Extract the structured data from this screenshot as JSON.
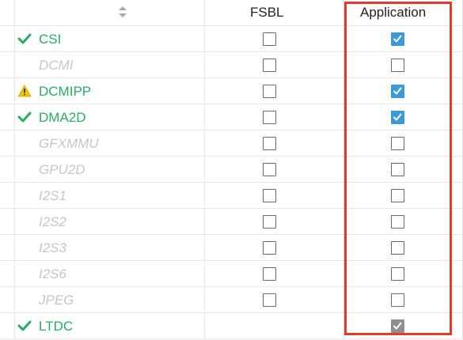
{
  "table": {
    "columns": [
      "",
      "FSBL",
      "Application"
    ],
    "rows": [
      {
        "name": "CSI",
        "status": "ok",
        "enabled": true,
        "fsbl": "unchecked",
        "application": "checked"
      },
      {
        "name": "DCMI",
        "status": "none",
        "enabled": false,
        "fsbl": "unchecked",
        "application": "unchecked"
      },
      {
        "name": "DCMIPP",
        "status": "warning",
        "enabled": true,
        "fsbl": "unchecked",
        "application": "checked"
      },
      {
        "name": "DMA2D",
        "status": "ok",
        "enabled": true,
        "fsbl": "unchecked",
        "application": "checked"
      },
      {
        "name": "GFXMMU",
        "status": "none",
        "enabled": false,
        "fsbl": "unchecked",
        "application": "unchecked"
      },
      {
        "name": "GPU2D",
        "status": "none",
        "enabled": false,
        "fsbl": "unchecked",
        "application": "unchecked"
      },
      {
        "name": "I2S1",
        "status": "none",
        "enabled": false,
        "fsbl": "unchecked",
        "application": "unchecked"
      },
      {
        "name": "I2S2",
        "status": "none",
        "enabled": false,
        "fsbl": "unchecked",
        "application": "unchecked"
      },
      {
        "name": "I2S3",
        "status": "none",
        "enabled": false,
        "fsbl": "unchecked",
        "application": "unchecked"
      },
      {
        "name": "I2S6",
        "status": "none",
        "enabled": false,
        "fsbl": "unchecked",
        "application": "unchecked"
      },
      {
        "name": "JPEG",
        "status": "none",
        "enabled": false,
        "fsbl": "unchecked",
        "application": "unchecked"
      },
      {
        "name": "LTDC",
        "status": "ok",
        "enabled": true,
        "fsbl": "none",
        "application": "checked-disabled"
      }
    ]
  },
  "colors": {
    "enabled_text": "#27ae60",
    "disabled_text": "#c6c6c6",
    "check_blue": "#3a9ad9",
    "check_gray": "#8f8f8f",
    "warning": "#f2c200",
    "highlight": "#e53a2a"
  },
  "icons": {
    "sort": "sort-updown-icon",
    "ok": "check-icon",
    "warning": "warning-icon"
  }
}
